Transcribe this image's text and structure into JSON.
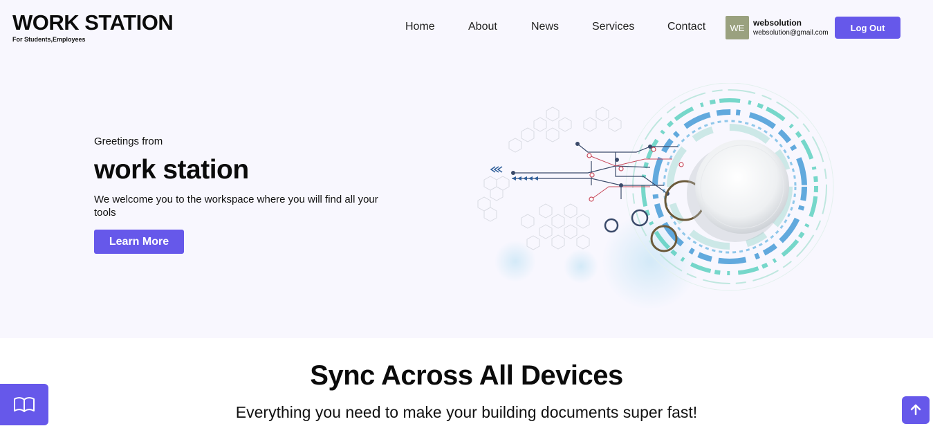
{
  "brand": {
    "title": "WORK STATION",
    "subtitle": "For Students,Employees"
  },
  "nav": {
    "items": [
      "Home",
      "About",
      "News",
      "Services",
      "Contact"
    ]
  },
  "user": {
    "initials": "WE",
    "name": "websolution",
    "email": "websolution@gmail.com",
    "logout_label": "Log Out"
  },
  "hero": {
    "greeting": "Greetings from",
    "title": "work station",
    "description": "We welcome you to the workspace where you will find all your tools",
    "button_label": "Learn More"
  },
  "section": {
    "title": "Sync Across All Devices",
    "subtitle": "Everything you need to make your building documents super fast!"
  },
  "icons": {
    "floating_left": "book-icon",
    "floating_right": "arrow-up-icon"
  },
  "colors": {
    "accent": "#6658ea",
    "hero_bg": "#f8f7fe",
    "avatar_bg": "#9aa17f",
    "teal": "#3fc9b4",
    "blue": "#2f8fd1"
  }
}
